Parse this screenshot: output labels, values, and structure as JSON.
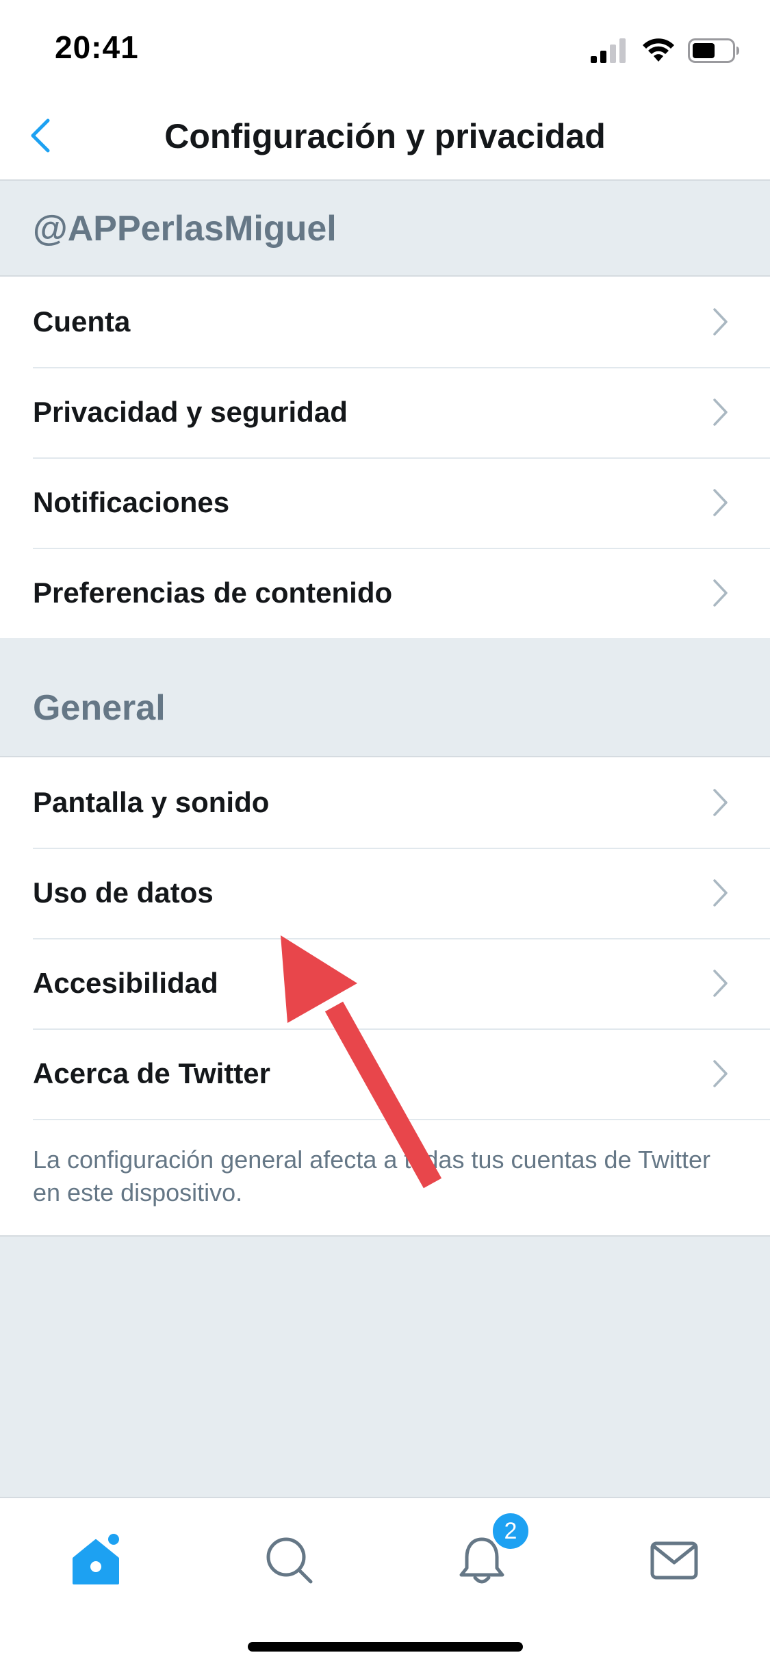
{
  "status_bar": {
    "time": "20:41"
  },
  "nav": {
    "title": "Configuración y privacidad",
    "back_icon": "chevron-left-icon"
  },
  "account_section": {
    "header": "@APPerlasMiguel",
    "items": [
      {
        "label": "Cuenta"
      },
      {
        "label": "Privacidad y seguridad"
      },
      {
        "label": "Notificaciones"
      },
      {
        "label": "Preferencias de contenido"
      }
    ]
  },
  "general_section": {
    "header": "General",
    "items": [
      {
        "label": "Pantalla y sonido"
      },
      {
        "label": "Uso de datos"
      },
      {
        "label": "Accesibilidad"
      },
      {
        "label": "Acerca de Twitter"
      }
    ],
    "footnote": "La configuración general afecta a todas tus cuentas de Twitter en este dispositivo."
  },
  "tab_bar": {
    "tabs": [
      {
        "name": "home",
        "icon": "home-icon",
        "active": true
      },
      {
        "name": "search",
        "icon": "search-icon",
        "active": false
      },
      {
        "name": "notifications",
        "icon": "bell-icon",
        "active": false
      },
      {
        "name": "messages",
        "icon": "mail-icon",
        "active": false
      }
    ],
    "notifications_badge": "2"
  },
  "colors": {
    "accent": "#1da1f2",
    "annotation": "#e8464b",
    "section_background": "#e6ecf0",
    "secondary_text": "#657786"
  }
}
